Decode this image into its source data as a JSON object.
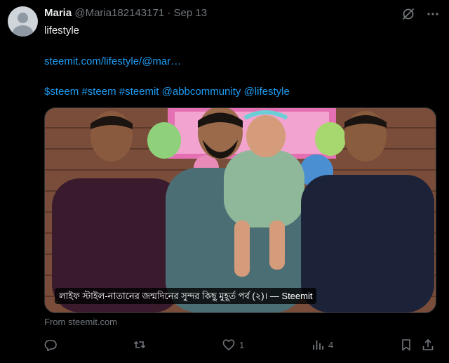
{
  "post": {
    "author_name": "Maria",
    "handle": "@Maria182143171",
    "separator": "·",
    "date": "Sep 13",
    "line1": "lifestyle",
    "link": "steemit.com/lifestyle/@mar…",
    "tags": [
      "$steem",
      "#steem",
      "#steemit",
      "@abbcommunity",
      "@lifestyle"
    ]
  },
  "card": {
    "caption": "লাইফ স্টাইল-নাতানের জন্মদিনের সুন্দর কিছু মুহূর্ত পর্ব (২)। — Steemit",
    "source": "From steemit.com"
  },
  "actions": {
    "reply_count": "",
    "repost_count": "",
    "like_count": "1",
    "views_count": "4"
  },
  "icons": {
    "grok": "grok-icon",
    "more": "more-icon",
    "reply": "reply-icon",
    "repost": "repost-icon",
    "like": "heart-icon",
    "views": "views-icon",
    "bookmark": "bookmark-icon",
    "share": "share-icon"
  },
  "colors": {
    "background": "#000000",
    "link": "#1d9bf0",
    "muted": "#71767b",
    "text": "#e7e9ea"
  }
}
